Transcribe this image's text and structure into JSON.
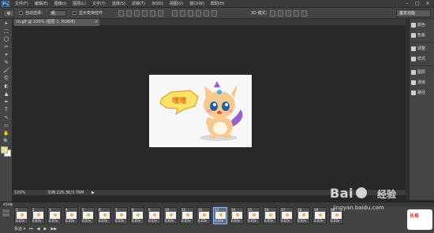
{
  "app": {
    "logo": "Ps"
  },
  "menu": [
    "文件(F)",
    "编辑(E)",
    "图像(I)",
    "图层(L)",
    "文字(Y)",
    "选择(S)",
    "滤镜(T)",
    "3D(D)",
    "视图(V)",
    "窗口(W)",
    "帮助(H)"
  ],
  "window_controls": {
    "minimize": "–",
    "maximize": "□",
    "close": "✕"
  },
  "options": {
    "auto_select_label": "自动选择：",
    "auto_select_value": "组",
    "show_transform_label": "显示变换控件",
    "mode_3d_label": "3D 模式：",
    "workspace": "基本功能"
  },
  "document": {
    "tab_title": "m.gif @ 100% (图层 1, RGB/8)",
    "tab_close": "×",
    "zoom": "100%",
    "doc_info": "文档:226.3K/3.76M",
    "status_arrow": "▶"
  },
  "tools": [
    "▸",
    "⬚",
    "◯",
    "✂",
    "⌗",
    "✎",
    "🖌",
    "⎘",
    "◐",
    "▲",
    "✒",
    "T",
    "↖",
    "▭",
    "✋",
    "🔍"
  ],
  "right_panel": [
    {
      "icon": "color-icon",
      "label": "颜色"
    },
    {
      "icon": "swatches-icon",
      "label": "色板"
    },
    {
      "icon": "adjustments-icon",
      "label": "调整"
    },
    {
      "icon": "styles-icon",
      "label": "样式"
    },
    {
      "icon": "layers-icon",
      "label": "图层"
    },
    {
      "icon": "channels-icon",
      "label": "通道"
    },
    {
      "icon": "paths-icon",
      "label": "路径"
    }
  ],
  "timeline": {
    "title": "时间轴",
    "frames": [
      {
        "num": "1",
        "delay": "0.07▾"
      },
      {
        "num": "2",
        "delay": "0.07▾"
      },
      {
        "num": "3",
        "delay": "0.07▾"
      },
      {
        "num": "4",
        "delay": "0.07▾"
      },
      {
        "num": "5",
        "delay": "0.07▾"
      },
      {
        "num": "6",
        "delay": "0.07▾"
      },
      {
        "num": "7",
        "delay": "0.07▾"
      },
      {
        "num": "8",
        "delay": "0.07▾"
      },
      {
        "num": "9",
        "delay": "0.07▾"
      },
      {
        "num": "10",
        "delay": "0.07▾"
      },
      {
        "num": "11",
        "delay": "0.07▾"
      },
      {
        "num": "12",
        "delay": "0.07▾"
      },
      {
        "num": "13",
        "delay": "0.07▾"
      },
      {
        "num": "14",
        "delay": "0.07▾"
      },
      {
        "num": "15",
        "delay": "0.07▾"
      },
      {
        "num": "16",
        "delay": "0.07▾"
      },
      {
        "num": "17",
        "delay": "0.07▾"
      },
      {
        "num": "18",
        "delay": "0.07▾"
      },
      {
        "num": "19",
        "delay": "0.07▾"
      },
      {
        "num": "20",
        "delay": "0.07▾"
      }
    ],
    "selected_frame": 12,
    "loop_label": "永远 ▾",
    "controls": [
      "⏮",
      "◀",
      "▶",
      "▶▶"
    ]
  },
  "canvas_image": {
    "bubble_text": "嘿嘿"
  },
  "watermark": {
    "brand": "Bai",
    "brand2": "经验",
    "url": "jingyan.baidu.com",
    "badge": "长易"
  },
  "colors": {
    "accent": "#8ab4ff",
    "workspace_bg": "#282828",
    "panel_bg": "#454545"
  }
}
